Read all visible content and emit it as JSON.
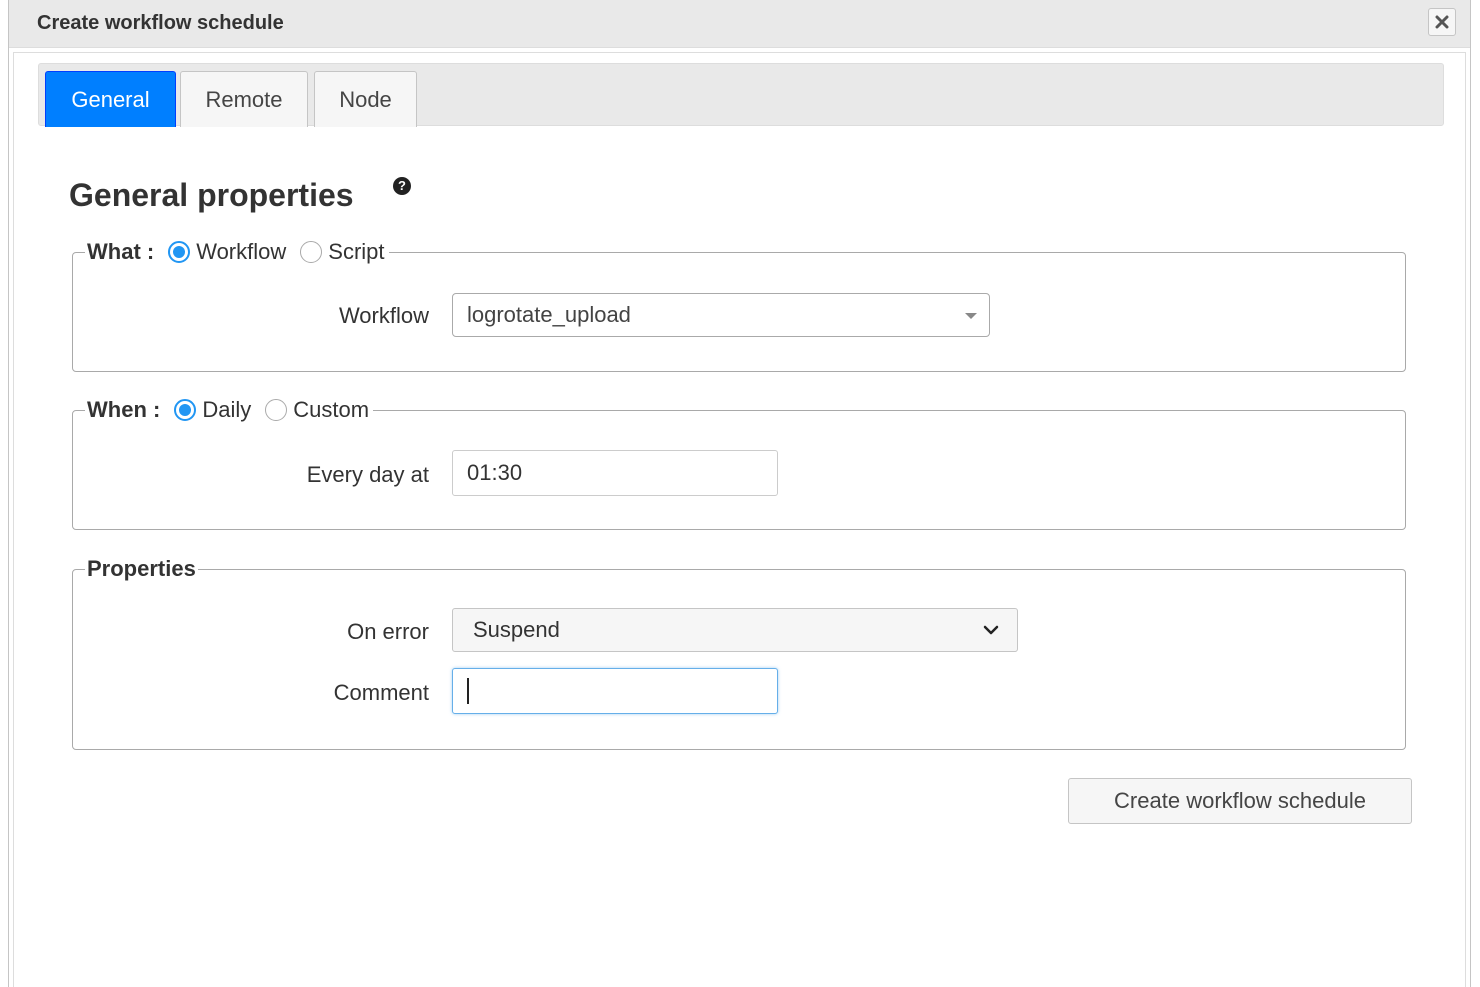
{
  "dialog": {
    "title": "Create workflow schedule",
    "close_icon": "close-icon"
  },
  "tabs": [
    {
      "label": "General",
      "active": true
    },
    {
      "label": "Remote",
      "active": false
    },
    {
      "label": "Node",
      "active": false
    }
  ],
  "general": {
    "heading": "General properties",
    "help_icon": "?"
  },
  "what": {
    "label": "What :",
    "options": [
      {
        "label": "Workflow",
        "checked": true
      },
      {
        "label": "Script",
        "checked": false
      }
    ],
    "workflow_label": "Workflow",
    "workflow_value": "logrotate_upload"
  },
  "when": {
    "label": "When :",
    "options": [
      {
        "label": "Daily",
        "checked": true
      },
      {
        "label": "Custom",
        "checked": false
      }
    ],
    "every_day_label": "Every day at",
    "every_day_value": "01:30"
  },
  "properties": {
    "label": "Properties",
    "on_error_label": "On error",
    "on_error_value": "Suspend",
    "comment_label": "Comment",
    "comment_value": ""
  },
  "actions": {
    "submit_label": "Create workflow schedule"
  },
  "colors": {
    "accent": "#007fff",
    "radio": "#2196f3",
    "focus": "#66afe9"
  }
}
